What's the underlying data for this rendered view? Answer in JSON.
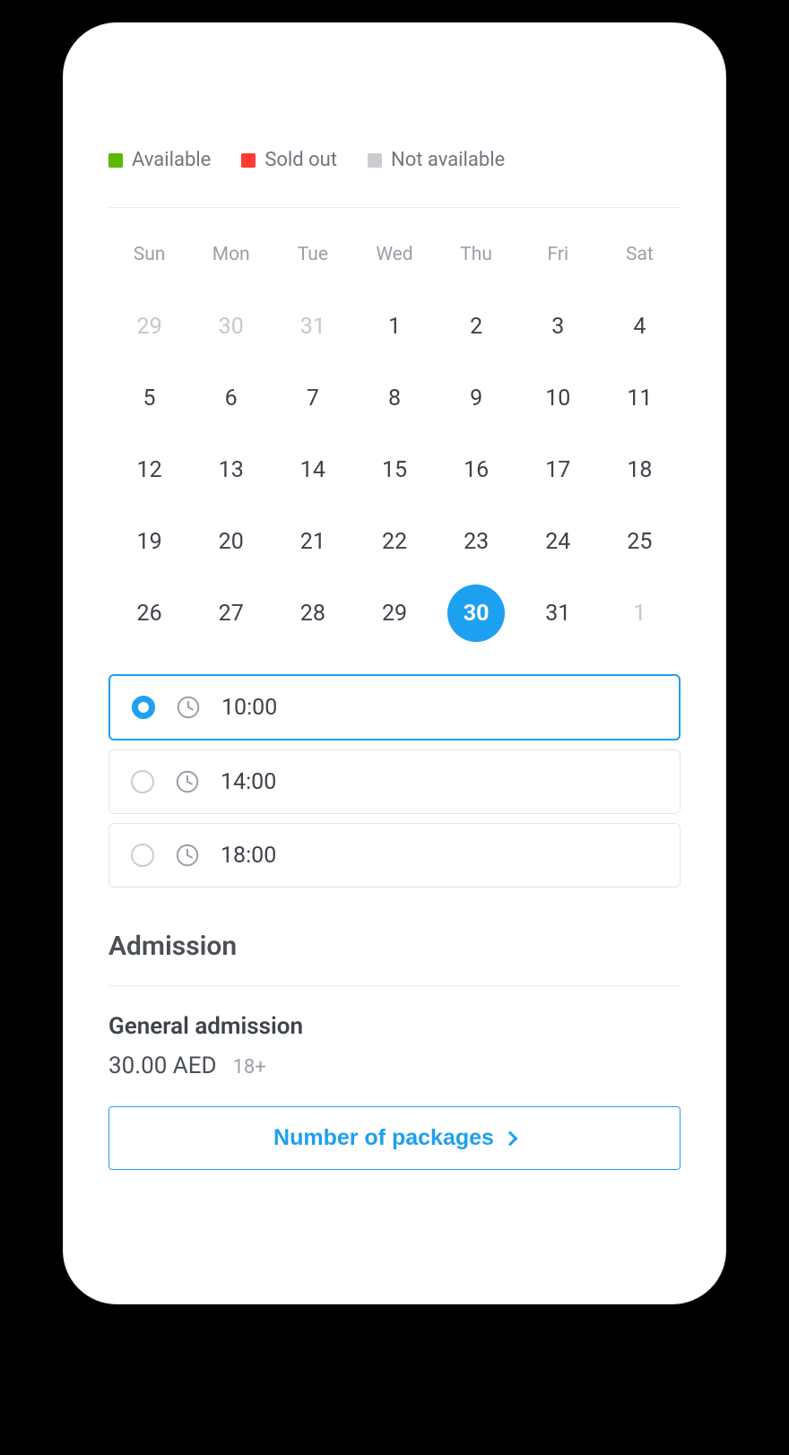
{
  "legend": {
    "available": "Available",
    "sold_out": "Sold out",
    "not_available": "Not available"
  },
  "calendar": {
    "dow": [
      "Sun",
      "Mon",
      "Tue",
      "Wed",
      "Thu",
      "Fri",
      "Sat"
    ],
    "weeks": [
      [
        {
          "d": "29",
          "muted": true
        },
        {
          "d": "30",
          "muted": true
        },
        {
          "d": "31",
          "muted": true
        },
        {
          "d": "1"
        },
        {
          "d": "2"
        },
        {
          "d": "3"
        },
        {
          "d": "4"
        }
      ],
      [
        {
          "d": "5"
        },
        {
          "d": "6"
        },
        {
          "d": "7"
        },
        {
          "d": "8"
        },
        {
          "d": "9"
        },
        {
          "d": "10"
        },
        {
          "d": "11"
        }
      ],
      [
        {
          "d": "12"
        },
        {
          "d": "13"
        },
        {
          "d": "14"
        },
        {
          "d": "15"
        },
        {
          "d": "16"
        },
        {
          "d": "17"
        },
        {
          "d": "18"
        }
      ],
      [
        {
          "d": "19"
        },
        {
          "d": "20"
        },
        {
          "d": "21"
        },
        {
          "d": "22"
        },
        {
          "d": "23"
        },
        {
          "d": "24"
        },
        {
          "d": "25"
        }
      ],
      [
        {
          "d": "26"
        },
        {
          "d": "27"
        },
        {
          "d": "28"
        },
        {
          "d": "29"
        },
        {
          "d": "30",
          "selected": true
        },
        {
          "d": "31"
        },
        {
          "d": "1",
          "muted": true
        }
      ]
    ]
  },
  "timeslots": [
    {
      "time": "10:00",
      "selected": true
    },
    {
      "time": "14:00",
      "selected": false
    },
    {
      "time": "18:00",
      "selected": false
    }
  ],
  "admission": {
    "heading": "Admission",
    "ticket_name": "General admission",
    "price": "30.00 AED",
    "age": "18+",
    "packages_label": "Number of packages"
  }
}
